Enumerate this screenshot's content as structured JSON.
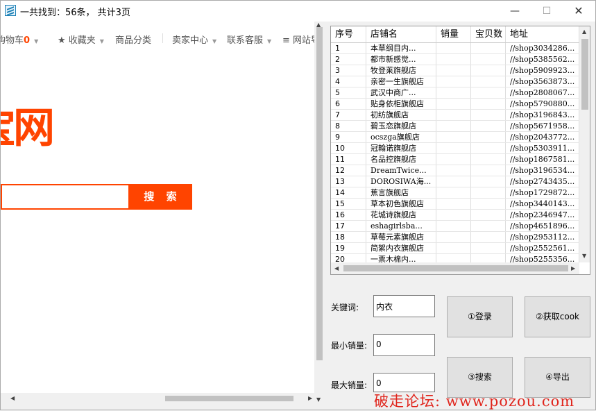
{
  "window": {
    "title": "一共找到：56条， 共计3页",
    "minimize": "—",
    "maximize": "☐",
    "close": "✕"
  },
  "browser": {
    "nav": {
      "cart_label": "购物车",
      "cart_count": "0",
      "favorites_label": "★ 收藏夹",
      "category_label": "商品分类",
      "seller_label": "卖家中心",
      "service_label": "联系客服",
      "sitenav_label": "≡ 网站导航"
    },
    "logo_text": "宝网",
    "search_button": "搜 索"
  },
  "table": {
    "headers": [
      "序号",
      "店铺名",
      "销量",
      "宝贝数",
      "地址"
    ],
    "rows": [
      [
        "1",
        "本草纲目内...",
        "",
        "",
        "//shop3034286..."
      ],
      [
        "2",
        "都市新感觉...",
        "",
        "",
        "//shop5385562..."
      ],
      [
        "3",
        "牧登莱旗舰店",
        "",
        "",
        "//shop5909923..."
      ],
      [
        "4",
        "亲密一生旗舰店",
        "",
        "",
        "//shop3563873..."
      ],
      [
        "5",
        "武汉中商广...",
        "",
        "",
        "//shop2808067..."
      ],
      [
        "6",
        "贴身依柜旗舰店",
        "",
        "",
        "//shop5790880..."
      ],
      [
        "7",
        "初纺旗舰店",
        "",
        "",
        "//shop3196843..."
      ],
      [
        "8",
        "碧玉恋旗舰店",
        "",
        "",
        "//shop5671958..."
      ],
      [
        "9",
        "ocszga旗舰店",
        "",
        "",
        "//shop2043772..."
      ],
      [
        "10",
        "冠翰诺旗舰店",
        "",
        "",
        "//shop5303911..."
      ],
      [
        "11",
        "名品控旗舰店",
        "",
        "",
        "//shop1867581..."
      ],
      [
        "12",
        "DreamTwice...",
        "",
        "",
        "//shop3196534..."
      ],
      [
        "13",
        "DOROSIWA海...",
        "",
        "",
        "//shop2743435..."
      ],
      [
        "14",
        "蕉言旗舰店",
        "",
        "",
        "//shop1729872..."
      ],
      [
        "15",
        "草本初色旗舰店",
        "",
        "",
        "//shop3440143..."
      ],
      [
        "16",
        "花城诗旗舰店",
        "",
        "",
        "//shop2346947..."
      ],
      [
        "17",
        "eshagirlsba...",
        "",
        "",
        "//shop4651896..."
      ],
      [
        "18",
        "草莓元素旗舰店",
        "",
        "",
        "//shop2953112..."
      ],
      [
        "19",
        "简絮内衣旗舰店",
        "",
        "",
        "//shop2552561..."
      ],
      [
        "20",
        "一票木棉内...",
        "",
        "",
        "//shop5255356..."
      ]
    ]
  },
  "form": {
    "keyword_label": "关键词:",
    "keyword_value": "内衣",
    "min_sales_label": "最小销量:",
    "min_sales_value": "0",
    "max_sales_label": "最大销量:",
    "max_sales_value": "0"
  },
  "buttons": {
    "login": "①登录",
    "get_cookie": "②获取cook",
    "search": "③搜索",
    "export": "④导出"
  },
  "watermark": "破走论坛: www.pozou.com"
}
